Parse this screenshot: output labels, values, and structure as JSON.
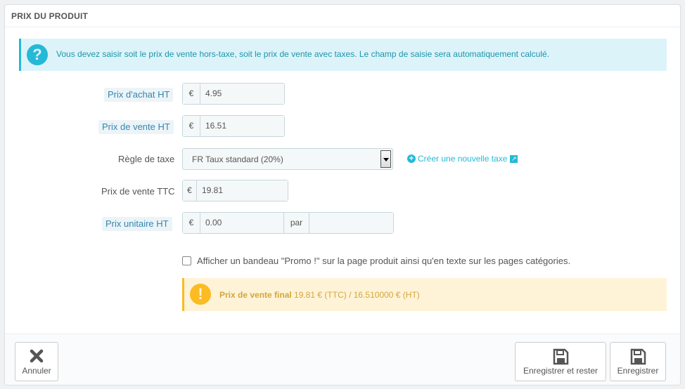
{
  "panel": {
    "title": "PRIX DU PRODUIT"
  },
  "info_alert": {
    "text": "Vous devez saisir soit le prix de vente hors-taxe, soit le prix de vente avec taxes. Le champ de saisie sera automatiquement calculé.",
    "icon": "question-icon"
  },
  "currency": "€",
  "fields": {
    "wholesale": {
      "label": "Prix d'achat HT",
      "value": "4.95"
    },
    "price_ht": {
      "label": "Prix de vente HT",
      "value": "16.51"
    },
    "tax_rule": {
      "label": "Règle de taxe",
      "value": "FR Taux standard (20%)"
    },
    "price_ttc": {
      "label": "Prix de vente TTC",
      "value": "19.81"
    },
    "unit_price": {
      "label": "Prix unitaire HT",
      "value": "0.00",
      "per_label": "par",
      "unity": ""
    }
  },
  "new_tax_link": "Créer une nouvelle taxe",
  "on_sale": {
    "label": "Afficher un bandeau \"Promo !\" sur la page produit ainsi qu'en texte sur les pages catégories.",
    "checked": false
  },
  "final_price": {
    "label": "Prix de vente final",
    "value": "19.81 € (TTC) / 16.510000 € (HT)"
  },
  "footer": {
    "cancel": "Annuler",
    "save_stay": "Enregistrer et rester",
    "save": "Enregistrer"
  },
  "colors": {
    "info": "#25b9d7",
    "warning": "#fbbb22"
  }
}
